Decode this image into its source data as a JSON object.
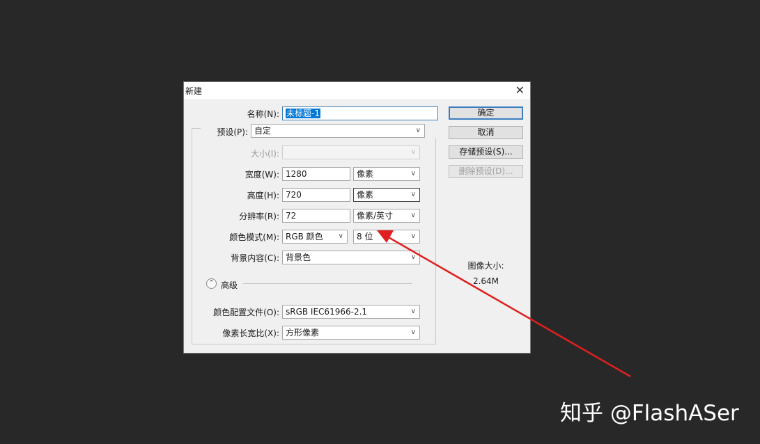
{
  "dialog": {
    "title": "新建",
    "close_glyph": "✕",
    "name": {
      "label": "名称(N):",
      "value": "未标题-1"
    },
    "preset": {
      "label": "预设(P):",
      "value": "自定"
    },
    "size": {
      "label": "大小(I):",
      "value": ""
    },
    "width": {
      "label": "宽度(W):",
      "value": "1280",
      "unit": "像素"
    },
    "height": {
      "label": "高度(H):",
      "value": "720",
      "unit": "像素"
    },
    "resolution": {
      "label": "分辨率(R):",
      "value": "72",
      "unit": "像素/英寸"
    },
    "color_mode": {
      "label": "颜色模式(M):",
      "value": "RGB 颜色",
      "depth": "8 位"
    },
    "background": {
      "label": "背景内容(C):",
      "value": "背景色"
    },
    "advanced": {
      "label": "高级",
      "toggle_glyph": "⌃"
    },
    "color_profile": {
      "label": "颜色配置文件(O):",
      "value": "sRGB IEC61966-2.1"
    },
    "pixel_aspect": {
      "label": "像素长宽比(X):",
      "value": "方形像素"
    },
    "buttons": {
      "ok": "确定",
      "cancel": "取消",
      "save_preset": "存储预设(S)...",
      "delete_preset": "删除预设(D)..."
    },
    "image_size": {
      "label": "图像大小:",
      "value": "2.64M"
    }
  },
  "dropdown_glyph": "∨",
  "watermark": "知乎 @FlashASer",
  "colors": {
    "background": "#282828",
    "dialog": "#f0f0f0",
    "arrow": "#e02020",
    "accent": "#3b7cbf"
  }
}
